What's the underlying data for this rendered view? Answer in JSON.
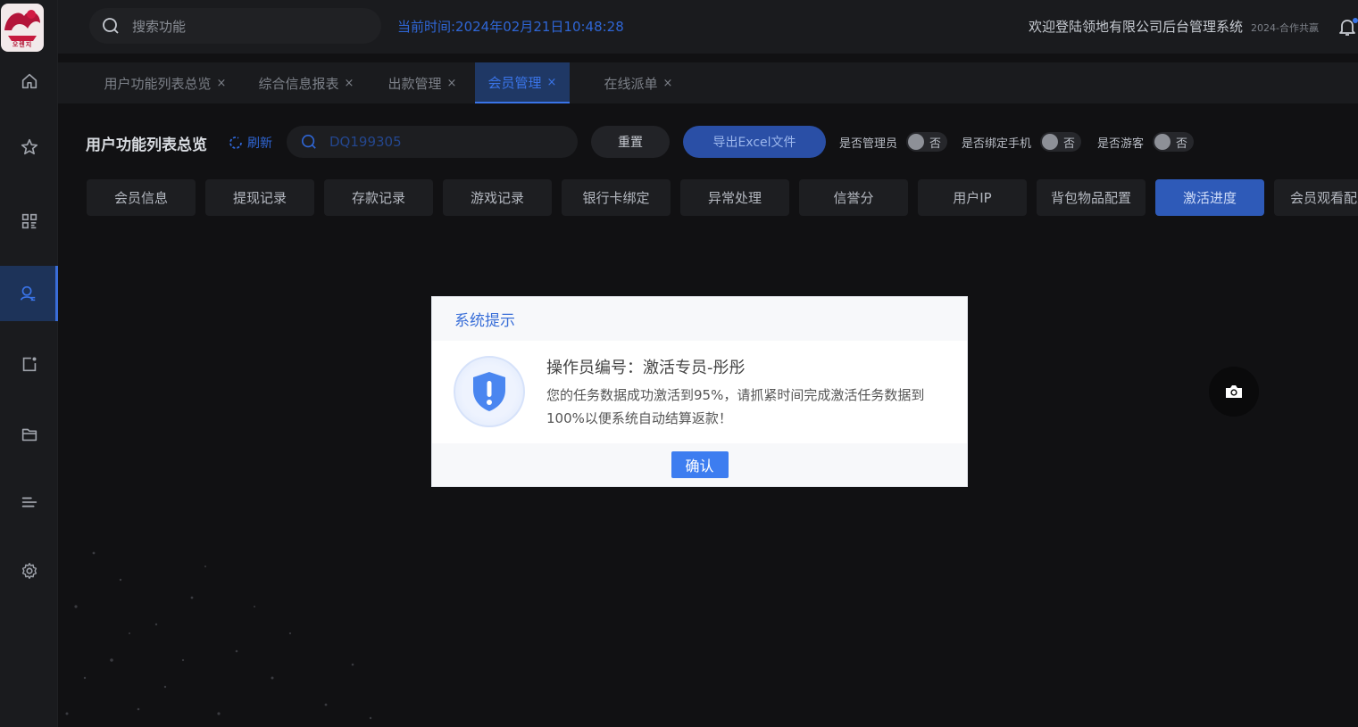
{
  "app": {
    "logo_text": "오렌지",
    "search_placeholder": "搜索功能",
    "clock_text": "当前时间:2024年02月21日10:48:28",
    "welcome_text": "欢迎登陆领地有限公司后台管理系统",
    "copyright_text": "2024-合作共赢"
  },
  "sidebar": {
    "items": [
      {
        "icon": "home-icon"
      },
      {
        "icon": "star-icon"
      },
      {
        "icon": "grid-icon"
      },
      {
        "icon": "user-icon",
        "active": true
      },
      {
        "icon": "edit-note-icon"
      },
      {
        "icon": "folder-icon"
      },
      {
        "icon": "list-icon"
      },
      {
        "icon": "settings-icon"
      }
    ]
  },
  "tabs": [
    {
      "label": "用户功能列表总览",
      "close": "×"
    },
    {
      "label": "综合信息报表",
      "close": "×"
    },
    {
      "label": "出款管理",
      "close": "×"
    },
    {
      "label": "会员管理",
      "close": "×",
      "active": true
    },
    {
      "label": "在线派单",
      "close": "×"
    }
  ],
  "filter": {
    "page_title": "用户功能列表总览",
    "refresh_label": "刷新",
    "search_value": "DQ199305",
    "reset_label": "重置",
    "export_label": "导出Excel文件",
    "toggles": [
      {
        "label": "是否管理员",
        "value": "否"
      },
      {
        "label": "是否绑定手机",
        "value": "否"
      },
      {
        "label": "是否游客",
        "value": "否"
      }
    ]
  },
  "subtabs": [
    "会员信息",
    "提现记录",
    "存款记录",
    "游戏记录",
    "银行卡绑定",
    "异常处理",
    "信誉分",
    "用户IP",
    "背包物品配置",
    "激活进度",
    "会员观看配置"
  ],
  "active_subtab": "激活进度",
  "modal": {
    "title": "系统提示",
    "heading": "操作员编号：激活专员-彤彤",
    "message": "您的任务数据成功激活到95%，请抓紧时间完成激活任务数据到100%以便系统自动结算返款！",
    "confirm_label": "确认"
  },
  "colors": {
    "accent": "#3a74e8",
    "background": "#111113",
    "panel": "#1a1b1e"
  }
}
